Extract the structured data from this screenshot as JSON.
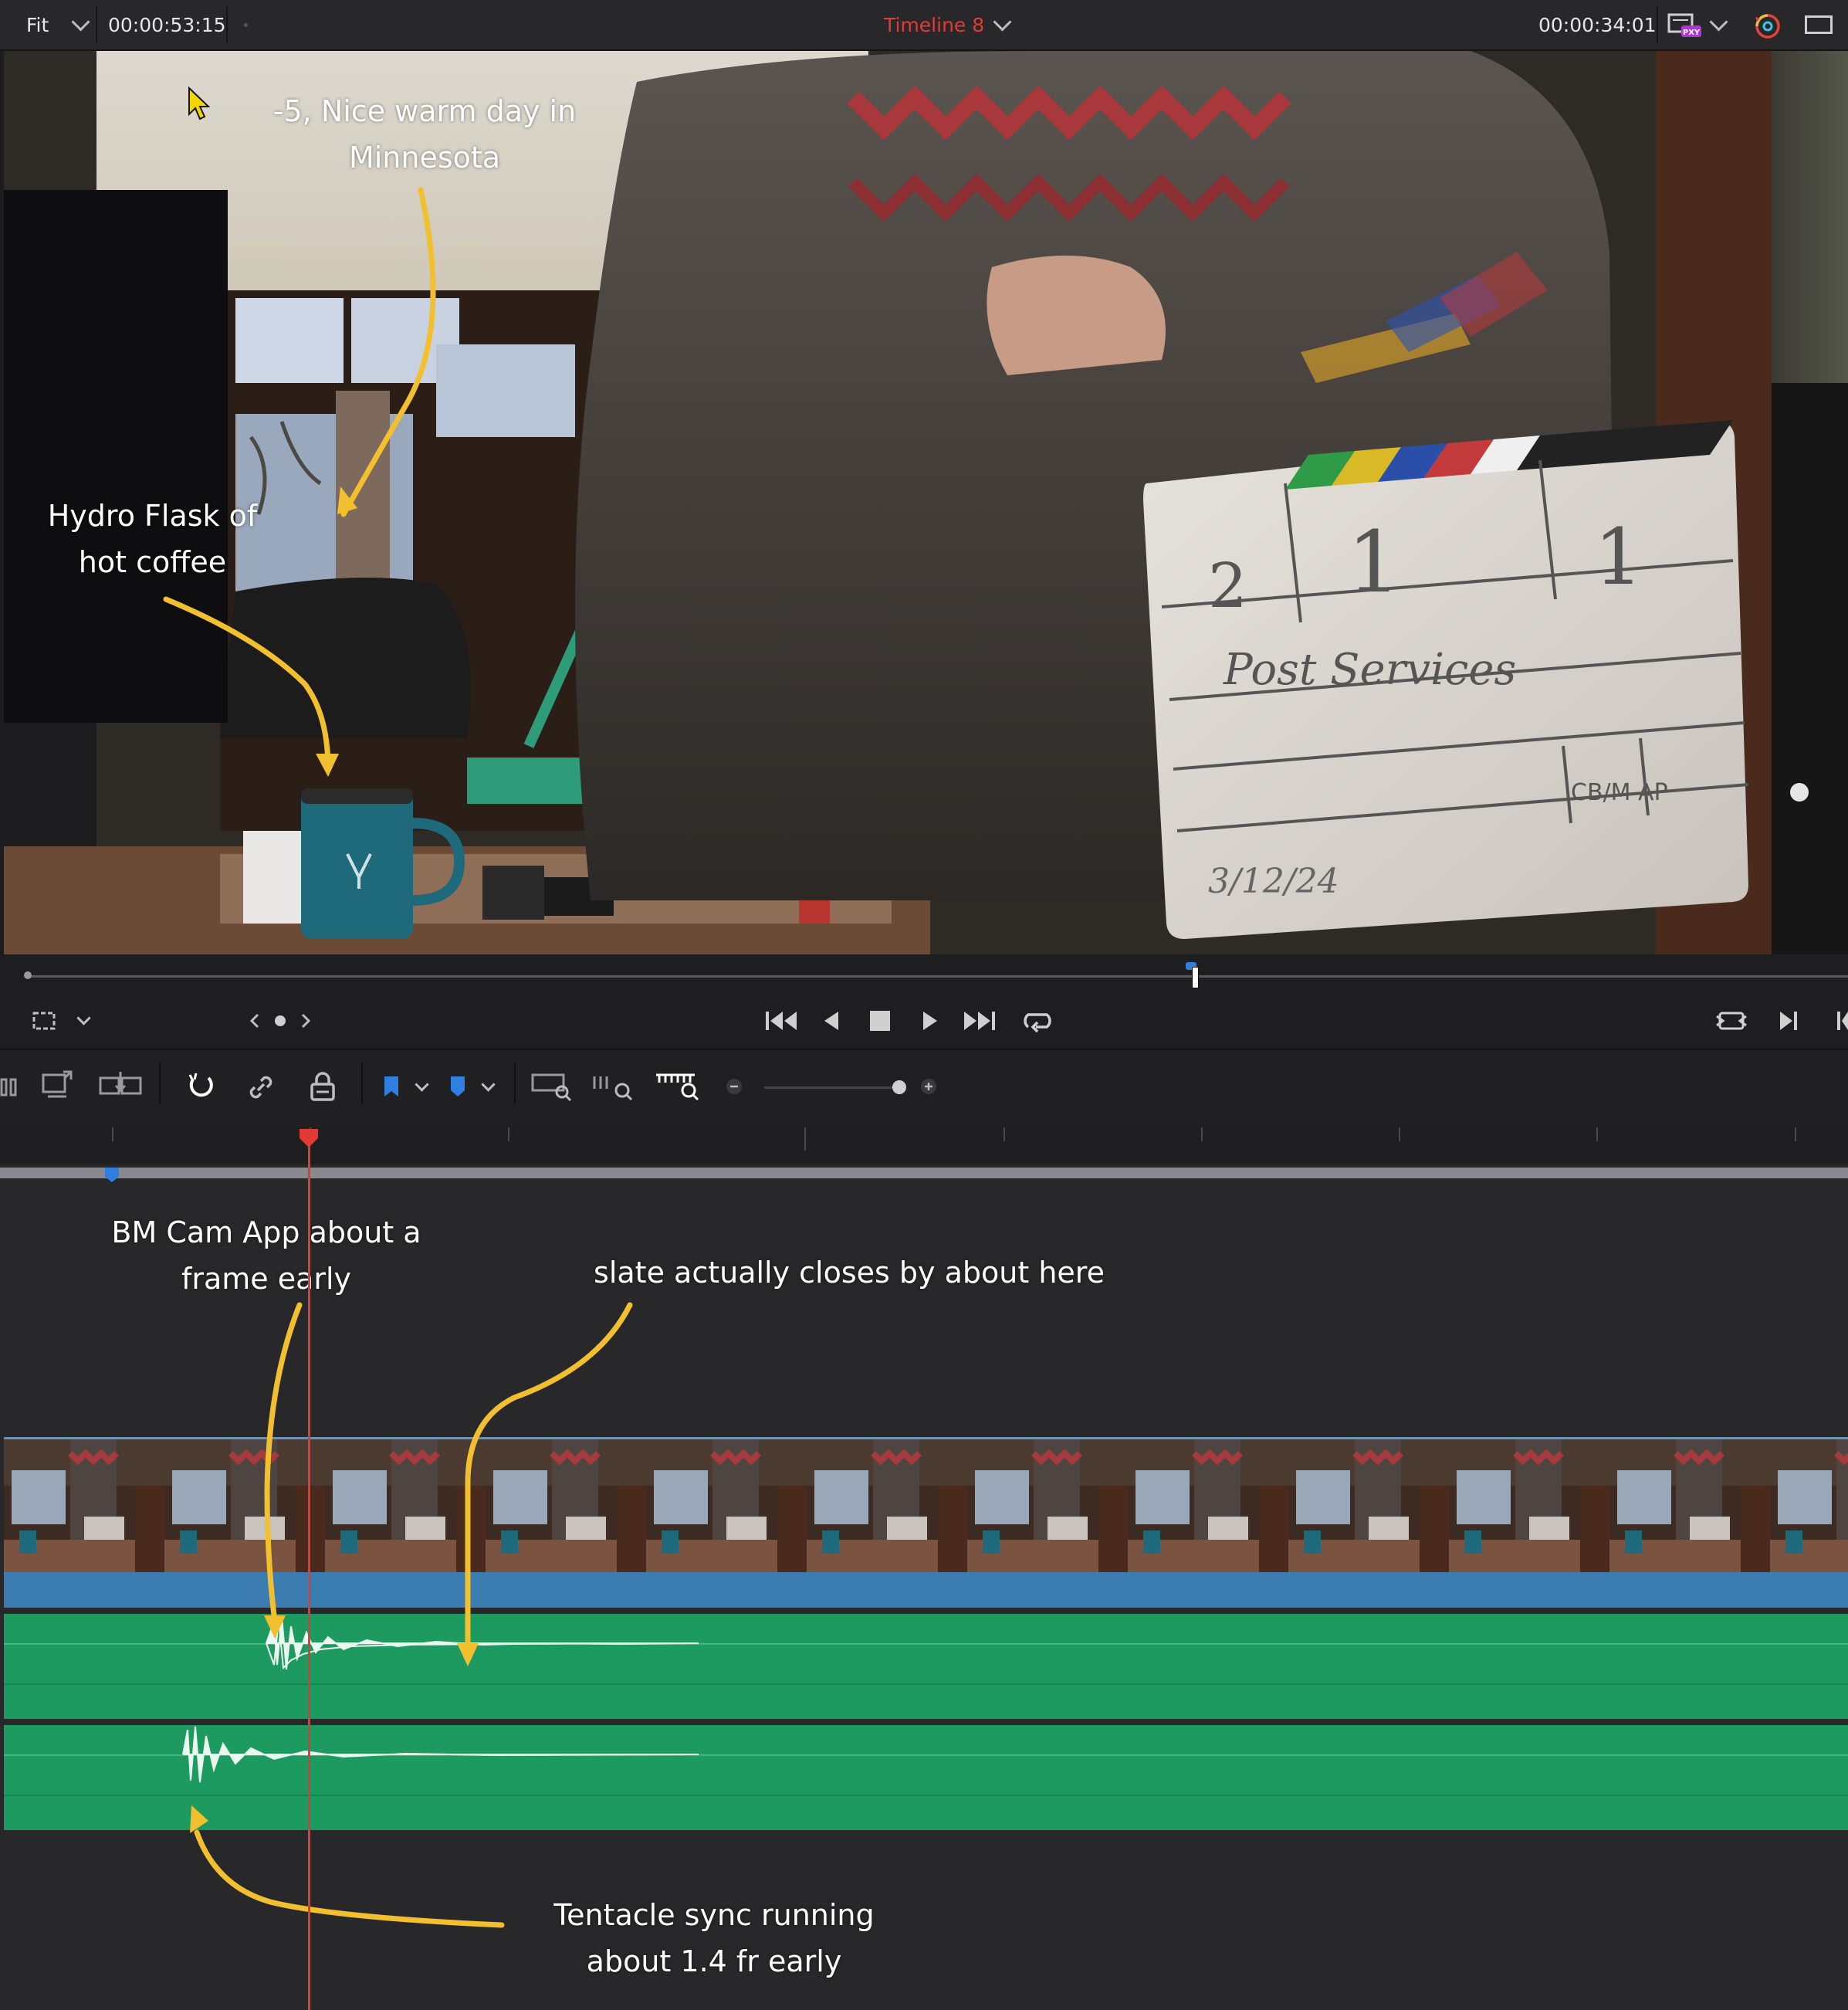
{
  "topbar": {
    "zoom_label": "Fit",
    "source_timecode": "00:00:53:15",
    "timeline_name": "Timeline 8",
    "record_timecode": "00:00:34:01",
    "proxy_badge": "PXY",
    "accent_color": "#e23b35"
  },
  "viewer": {
    "slate": {
      "roll": "2",
      "scene": "1",
      "take": "1",
      "production": "Post Services",
      "cam": "CB/M AP",
      "date": "3/12/24"
    },
    "annotations": {
      "weather": "-5, Nice warm day in Minnesota",
      "flask": "Hydro Flask of hot coffee"
    }
  },
  "transport": {
    "icons": [
      "crop-icon",
      "nav-dots-icon",
      "jump-start-icon",
      "step-back-icon",
      "stop-icon",
      "play-icon",
      "jump-end-icon",
      "loop-icon",
      "match-frame-icon",
      "next-edit-icon"
    ]
  },
  "timeline": {
    "annotations": {
      "bm_cam": "BM Cam App about a frame early",
      "slate_close": "slate actually closes by about here",
      "tentacle": "Tentacle sync running about 1.4 fr early"
    },
    "colors": {
      "video_clip": "#3b7db1",
      "audio_clip": "#1d9a60",
      "marker": "#2f7fe0",
      "annotation_arrow": "#f2bf2f"
    }
  }
}
